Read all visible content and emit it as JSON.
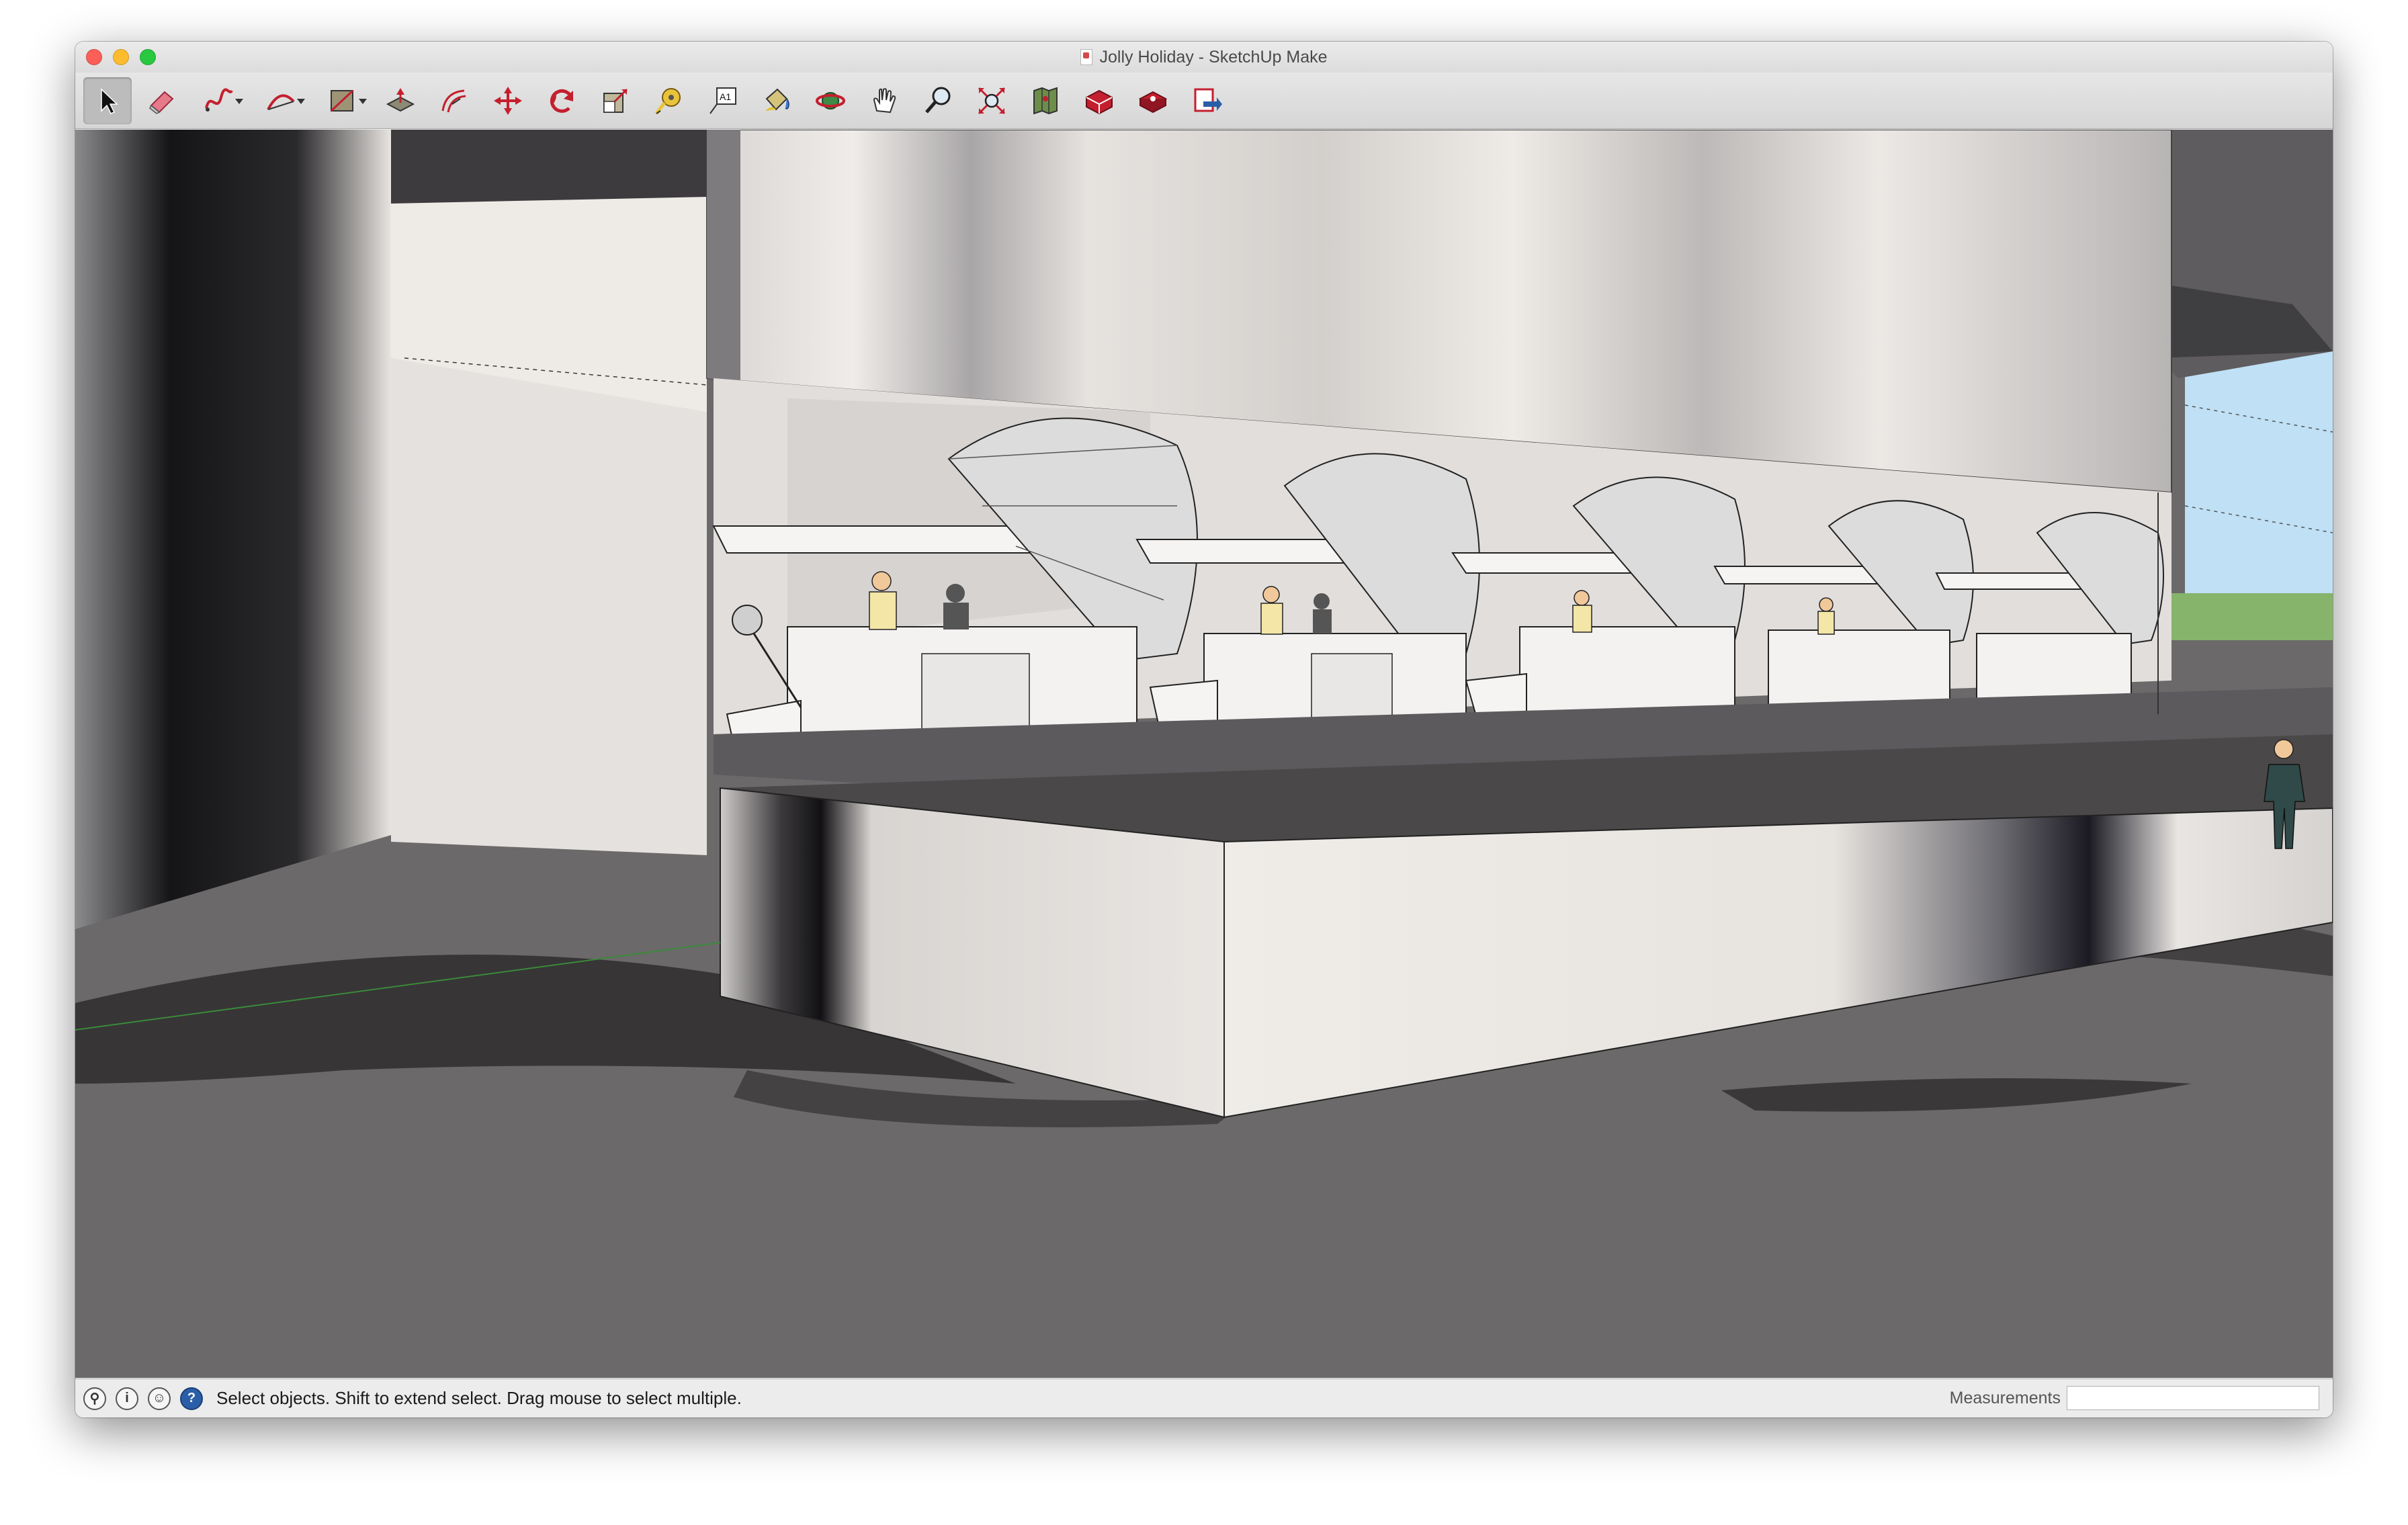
{
  "window": {
    "title": "Jolly Holiday - SketchUp Make"
  },
  "toolbar": {
    "tools": [
      {
        "name": "select-tool",
        "icon": "arrow-cursor-icon",
        "active": true
      },
      {
        "name": "eraser-tool",
        "icon": "eraser-icon"
      },
      {
        "name": "freehand-tool",
        "icon": "freehand-icon",
        "dropdown": true
      },
      {
        "name": "arc-tool",
        "icon": "arc-icon",
        "dropdown": true
      },
      {
        "name": "rectangle-tool",
        "icon": "rectangle-icon",
        "dropdown": true
      },
      {
        "name": "push-pull-tool",
        "icon": "push-pull-icon"
      },
      {
        "name": "offset-tool",
        "icon": "offset-icon"
      },
      {
        "name": "move-tool",
        "icon": "move-icon"
      },
      {
        "name": "rotate-tool",
        "icon": "rotate-icon"
      },
      {
        "name": "scale-tool",
        "icon": "scale-icon"
      },
      {
        "name": "tape-measure-tool",
        "icon": "tape-measure-icon"
      },
      {
        "name": "text-tool",
        "icon": "text-icon"
      },
      {
        "name": "paint-bucket-tool",
        "icon": "paint-bucket-icon"
      },
      {
        "name": "orbit-tool",
        "icon": "orbit-icon"
      },
      {
        "name": "pan-tool",
        "icon": "hand-icon"
      },
      {
        "name": "zoom-tool",
        "icon": "magnifier-icon"
      },
      {
        "name": "zoom-extents-tool",
        "icon": "zoom-extents-icon"
      },
      {
        "name": "add-location-tool",
        "icon": "map-icon"
      },
      {
        "name": "3d-warehouse-tool",
        "icon": "warehouse-icon"
      },
      {
        "name": "extension-warehouse-tool",
        "icon": "extension-icon"
      },
      {
        "name": "send-to-layout-tool",
        "icon": "layout-icon"
      }
    ]
  },
  "status": {
    "message": "Select objects. Shift to extend select. Drag mouse to select multiple.",
    "measurements_label": "Measurements",
    "measurements_value": ""
  },
  "colors": {
    "ground": "#6b6969",
    "sky": "#bfe0f5",
    "grass": "#86b46a",
    "building": "#e9e5e2"
  }
}
